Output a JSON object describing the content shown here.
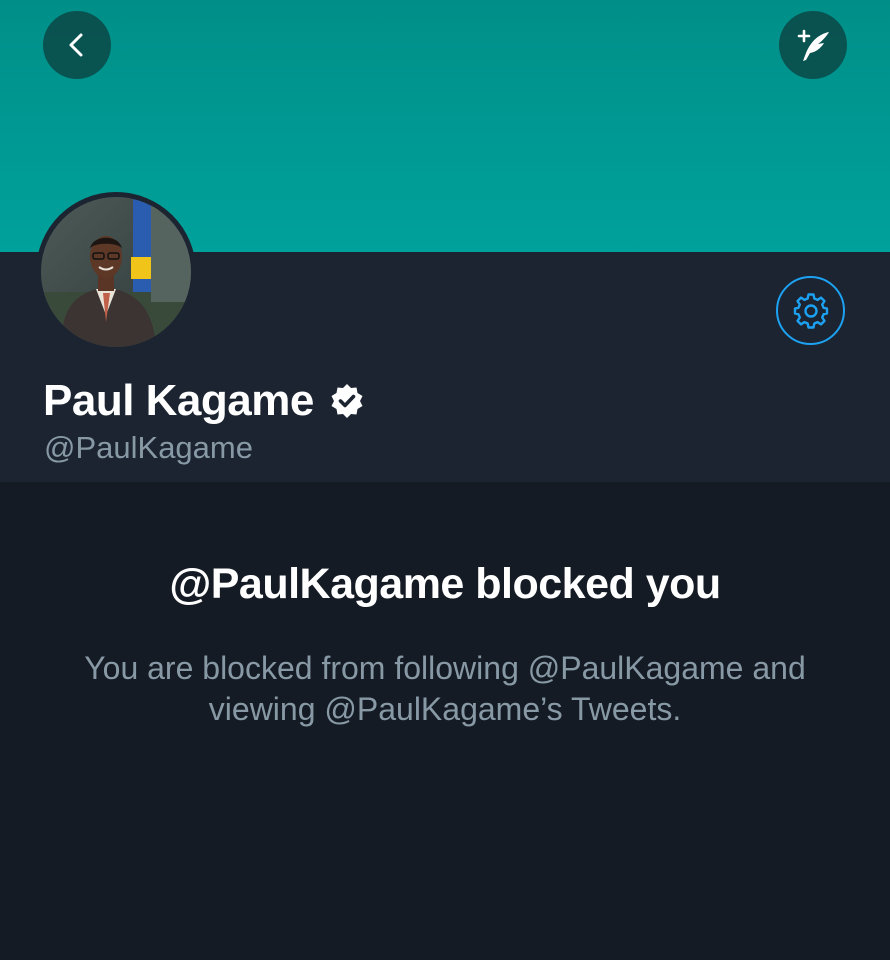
{
  "colors": {
    "banner": "#009993",
    "header_bg": "#1b2430",
    "page_bg": "#151b24",
    "accent": "#1da1f2",
    "muted_text": "#8899a6"
  },
  "icons": {
    "back": "chevron-left-icon",
    "compose": "compose-tweet-icon",
    "settings": "gear-icon",
    "verified": "verified-badge-icon"
  },
  "profile": {
    "name": "Paul Kagame",
    "handle": "@PaulKagame",
    "verified": true
  },
  "blocked": {
    "title": "@PaulKagame blocked you",
    "message": "You are blocked from following @PaulKagame and viewing @PaulKagame’s Tweets."
  }
}
